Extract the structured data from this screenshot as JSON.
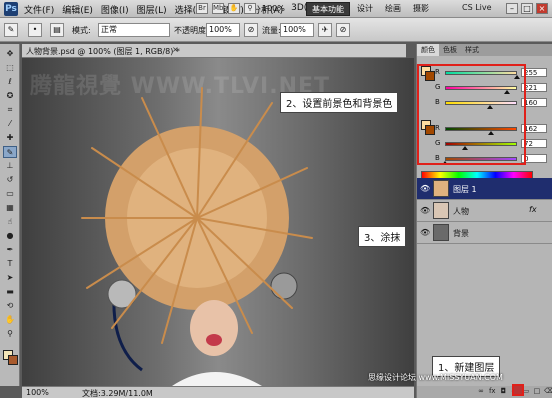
{
  "menubar": {
    "app_logo": "Ps",
    "items": [
      "文件(F)",
      "编辑(E)",
      "图像(I)",
      "图层(L)",
      "选择(S)",
      "滤镜(T)",
      "分析(A)",
      "3D(D)"
    ],
    "zoom": "100%",
    "workspaces": [
      "基本功能",
      "设计",
      "绘画",
      "摄影"
    ],
    "cs_live": "CS Live"
  },
  "options": {
    "mode_label": "模式:",
    "mode_value": "正常",
    "opacity_label": "不透明度:",
    "opacity_value": "100%",
    "flow_label": "流量:",
    "flow_value": "100%"
  },
  "document": {
    "tab_title": "人物背景.psd @ 100% (图层 1, RGB/8) *",
    "close": "×",
    "watermark": "腾龍視覺 WWW.TLVI.NET"
  },
  "status": {
    "zoom": "100%",
    "doc_size": "文档:3.29M/11.0M"
  },
  "color_panel": {
    "tabs": [
      "颜色",
      "色板",
      "样式"
    ],
    "foreground": [
      {
        "label": "R",
        "value": "255",
        "fraction": 1.0
      },
      {
        "label": "G",
        "value": "221",
        "fraction": 0.867
      },
      {
        "label": "B",
        "value": "160",
        "fraction": 0.627
      }
    ],
    "background": [
      {
        "label": "R",
        "value": "162",
        "fraction": 0.635
      },
      {
        "label": "G",
        "value": "72",
        "fraction": 0.282
      },
      {
        "label": "B",
        "value": "0",
        "fraction": 0.0
      }
    ],
    "fg_color": "#ffdda0",
    "bg_color": "#a24800"
  },
  "layers_panel": {
    "layers": [
      {
        "name": "图层 1",
        "selected": true,
        "fx": ""
      },
      {
        "name": "人物",
        "selected": false,
        "fx": "fx"
      },
      {
        "name": "背景",
        "selected": false,
        "fx": ""
      }
    ]
  },
  "callouts": {
    "set_colors": "2、设置前景色和背景色",
    "smudge": "3、涂抹",
    "new_layer": "1、新建图层"
  },
  "site_mark": "思缘设计论坛 www.MISSYUAN.COM",
  "colors": {
    "highlight_red": "#e0201a",
    "selected_layer": "#1f2d6e"
  }
}
